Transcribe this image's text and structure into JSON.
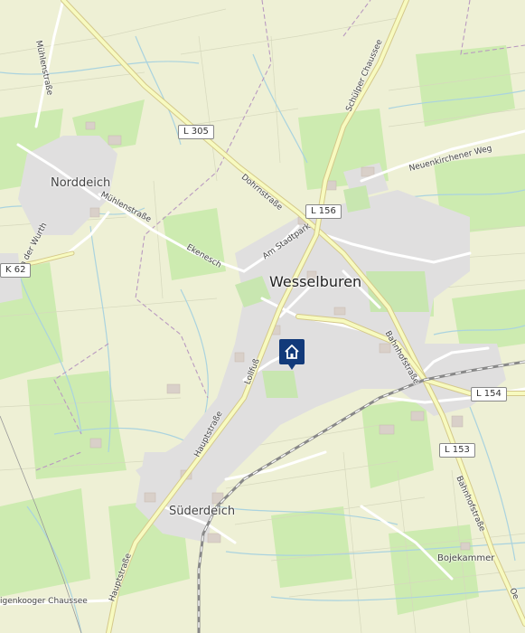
{
  "places": {
    "wesselburen": "Wesselburen",
    "norddeich": "Norddeich",
    "suederdeich": "Süderdeich",
    "bojekammer": "Bojekammer"
  },
  "streets": {
    "muehlenstrasse_north": "Mühlenstraße",
    "muehlenstrasse_west": "Mühlenstraße",
    "an_der_wurth": "An der Wurth",
    "ekenesch": "Ekenesch",
    "am_stadtpark": "Am Stadtpark",
    "dohrnstrasse": "Dohrnstraße",
    "schueler_chaussee": "Schülper Chaussee",
    "neuenkirchener_weg": "Neuenkirchener Weg",
    "bahnhofstrasse_1": "Bahnhofstraße",
    "bahnhofstrasse_2": "Bahnhofstraße",
    "loellfuss": "Lollfuß",
    "hauptstrasse_1": "Hauptstraße",
    "hauptstrasse_2": "Hauptstraße",
    "wiegenkooger_chaussee": "igenkooger Chaussee",
    "edge_label": "Oe"
  },
  "road_refs": {
    "l305": "L 305",
    "l156": "L 156",
    "k62": "K 62",
    "l154": "L 154",
    "l153": "L 153"
  },
  "marker": {
    "icon": "house-icon",
    "color": "#123a7a"
  },
  "colors": {
    "land": "#f2efe9",
    "farmland": "#eef0d5",
    "meadow": "#cdebb0",
    "residential": "#e0dfdf",
    "water": "#aad3df",
    "road_major": "#f7fabf",
    "railway": "#888888",
    "boundary": "#b99ac0"
  }
}
